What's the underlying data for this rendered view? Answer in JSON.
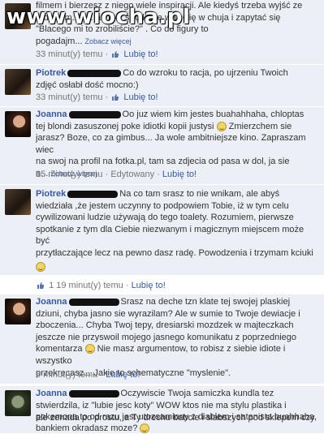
{
  "watermark": "www.wiocha.pl",
  "comments": [
    {
      "lines": [
        "filmem i bierzesz z niego wiele inspiracji. Ale kiedyś trzeba wyjść ze",
        "rodzicem..? … ach to: stro które wali Cię w chuja i zapytać się",
        "\"Blacego mi to zrobiliście?\" . Co do figury to",
        "pogadajm..."
      ],
      "more": "Zobacz więcej",
      "time": "33 minut(y) temu",
      "like": "Lubię to!"
    },
    {
      "name": "Piotrek",
      "text1": "Co do wzroku to racja, po ujrzeniu Twoich",
      "text2": "zdjęć osłabł dość mocno:)",
      "time": "33 minut(y) temu",
      "like": "Lubię to!"
    },
    {
      "name": "Joanna",
      "text1": "Oo juz wiem kim jestes buahahhaha, chloptas",
      "text2": "tej blondi zasuszonej poke idiotki kopii justysi",
      "text2b": "Zmierzchem sie",
      "text3": "jarasz? Boze, co za gimbus... Ja wole ambitniejsze kino. Zapraszam wiec",
      "text4": "na swoj na profil na fotka.pl, tam sa zdjecia od pasa w dol, ja sie",
      "text5": "n...",
      "more": "Zobacz więcej",
      "time": "15 minut(y) temu",
      "edited": "Edytowany",
      "like": "Lubię to!"
    },
    {
      "name": "Piotrek",
      "text1": "Na co tam srasz to nie wnikam, ale abyś",
      "text2": "wiedziała ,że jestem uczynny to podpowiem Tobie, iż w tym celu",
      "text3": "cywilizowani ludzie używają do tego toalety. Rozumiem, pierwsze",
      "text4": "spotkanie z tym dla Ciebie niezwanym i magicznym miejscem może być",
      "text5": "przytłaczające lecz na pewno dasz radę. Powodzenia i trzymam kciuki",
      "count": "1",
      "time": "19 minut(y) temu",
      "like": "Lubię to!"
    },
    {
      "name": "Joanna",
      "text1": "Srasz na deche tzn klate tej swojej plaskiej",
      "text2": "dziuni, chyba jasno sie wyrazilam? Ale w sumie to Twoje dewiacje i",
      "text3": "zboczenia... Chyba Twoj tepy, dresiarski mozdzek w majteczkach",
      "text4": "jeszcze nie przyswoil mojego jasnego komunikatu z poprzedniego",
      "text5a": "komentarza",
      "text5b": "Nie masz argumentow, to robisz z siebie idiote i wszystko",
      "text6": "przekrecasz... Jakie to schematyczne \"myslenie\".",
      "time": "6 minut(y) temu",
      "like": "Lubię to!"
    },
    {
      "name": "Joanna",
      "text1": "Oczywiscie Twoja samiczka kundla tez",
      "text2": "stwierdzila, iz \"lubie jesc koty\" WOW ktos nie ma stylu plastika i",
      "text3": "pokemona to od razu jest utozsamiony z diablem i satanista buahhaha,",
      "text4": "ale zenada po prostu, a Ty drechu babcie i slabszych pod sklepem czy",
      "text5": "bankiem okradasz moze?"
    }
  ]
}
